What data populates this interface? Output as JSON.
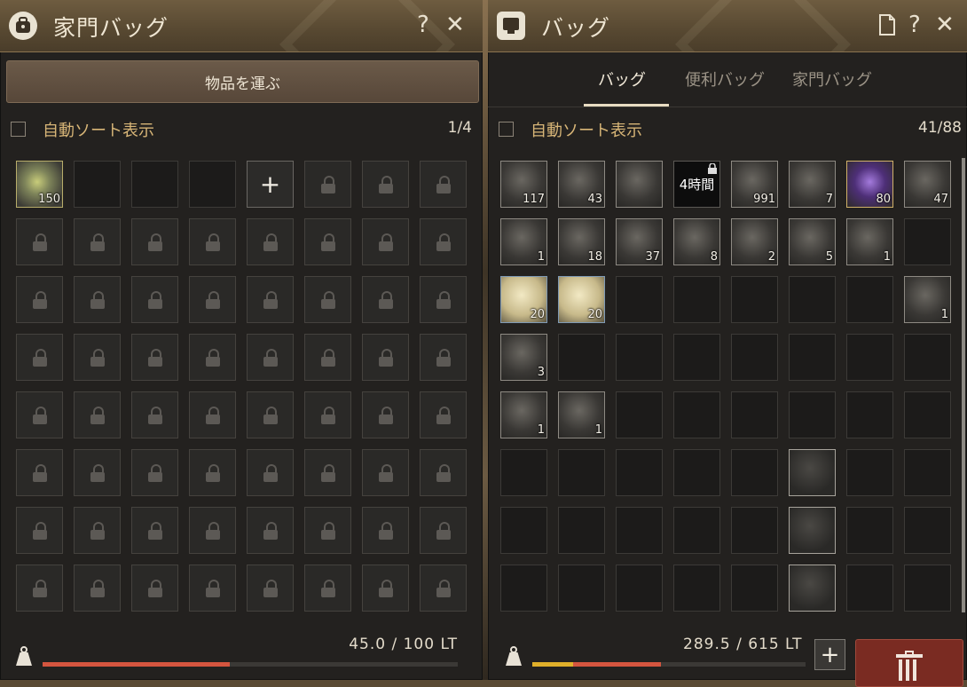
{
  "family_bag": {
    "title": "家門バッグ",
    "help": "?",
    "close": "✕",
    "carry_button": "物品を運ぶ",
    "sort_label": "自動ソート表示",
    "slot_count": "1/4",
    "slots": [
      {
        "type": "item",
        "style": "food",
        "qty": "150"
      },
      {
        "type": "empty"
      },
      {
        "type": "empty"
      },
      {
        "type": "empty"
      },
      {
        "type": "plus"
      },
      {
        "type": "locked"
      },
      {
        "type": "locked"
      },
      {
        "type": "locked"
      }
    ],
    "locked_rows": 7,
    "weight_text": "45.0 / 100 LT",
    "weight_fraction": 0.45,
    "weight_color": "#d4553f"
  },
  "bag": {
    "title": "バッグ",
    "help": "?",
    "close": "✕",
    "tabs": [
      "バッグ",
      "便利バッグ",
      "家門バッグ"
    ],
    "active_tab": 0,
    "sort_label": "自動ソート表示",
    "slot_count": "41/88",
    "slots": [
      {
        "type": "item",
        "qty": "117"
      },
      {
        "type": "item",
        "qty": "43"
      },
      {
        "type": "item",
        "qty": ""
      },
      {
        "type": "item",
        "style": "dark",
        "timer": "4時間",
        "lock": true
      },
      {
        "type": "item",
        "qty": "991"
      },
      {
        "type": "item",
        "qty": "7"
      },
      {
        "type": "item",
        "style": "purple",
        "qty": "80"
      },
      {
        "type": "item",
        "qty": "47"
      },
      {
        "type": "item",
        "qty": "1"
      },
      {
        "type": "item",
        "qty": "18"
      },
      {
        "type": "item",
        "qty": "37"
      },
      {
        "type": "item",
        "qty": "8"
      },
      {
        "type": "item",
        "qty": "2"
      },
      {
        "type": "item",
        "qty": "5"
      },
      {
        "type": "item",
        "qty": "1"
      },
      {
        "type": "empty"
      },
      {
        "type": "item",
        "style": "blue",
        "qty": "20"
      },
      {
        "type": "item",
        "style": "blue",
        "qty": "20"
      },
      {
        "type": "empty"
      },
      {
        "type": "empty"
      },
      {
        "type": "empty"
      },
      {
        "type": "empty"
      },
      {
        "type": "empty"
      },
      {
        "type": "item",
        "qty": "1"
      },
      {
        "type": "item",
        "qty": "3"
      },
      {
        "type": "empty"
      },
      {
        "type": "empty"
      },
      {
        "type": "empty"
      },
      {
        "type": "empty"
      },
      {
        "type": "empty"
      },
      {
        "type": "empty"
      },
      {
        "type": "empty"
      },
      {
        "type": "item",
        "qty": "1"
      },
      {
        "type": "item",
        "qty": "1"
      },
      {
        "type": "empty"
      },
      {
        "type": "empty"
      },
      {
        "type": "empty"
      },
      {
        "type": "empty"
      },
      {
        "type": "empty"
      },
      {
        "type": "empty"
      },
      {
        "type": "empty"
      },
      {
        "type": "empty"
      },
      {
        "type": "empty"
      },
      {
        "type": "empty"
      },
      {
        "type": "empty"
      },
      {
        "type": "item",
        "style": "faint",
        "qty": ""
      },
      {
        "type": "empty"
      },
      {
        "type": "empty"
      },
      {
        "type": "empty"
      },
      {
        "type": "empty"
      },
      {
        "type": "empty"
      },
      {
        "type": "empty"
      },
      {
        "type": "empty"
      },
      {
        "type": "item",
        "style": "faint",
        "qty": ""
      },
      {
        "type": "empty"
      },
      {
        "type": "empty"
      },
      {
        "type": "empty"
      },
      {
        "type": "empty"
      },
      {
        "type": "empty"
      },
      {
        "type": "empty"
      },
      {
        "type": "empty"
      },
      {
        "type": "item",
        "style": "faint",
        "qty": ""
      },
      {
        "type": "empty"
      },
      {
        "type": "empty"
      }
    ],
    "weight_text": "289.5 / 615 LT",
    "weight_segments": [
      {
        "fraction": 0.15,
        "color": "#e0b02a"
      },
      {
        "fraction": 0.32,
        "color": "#d4553f"
      }
    ],
    "add_label": "+"
  }
}
